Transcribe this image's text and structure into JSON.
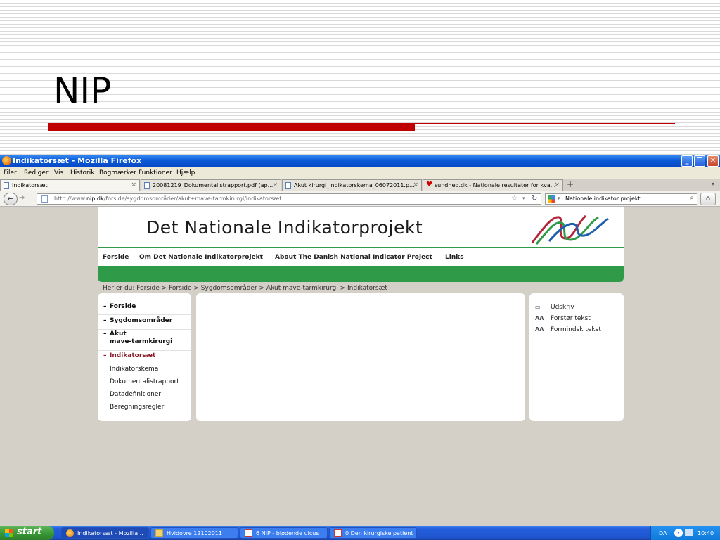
{
  "slide": {
    "title": "NIP"
  },
  "window": {
    "title": "Indikatorsæt - Mozilla Firefox"
  },
  "menu": [
    "Filer",
    "Rediger",
    "Vis",
    "Historik",
    "Bogmærker",
    "Funktioner",
    "Hjælp"
  ],
  "tabs": [
    {
      "label": "Indikatorsæt"
    },
    {
      "label": "20081219_Dokumentalistrapport.pdf (ap..."
    },
    {
      "label": "Akut kirurgi_indikatorskema_06072011.p..."
    },
    {
      "label": "sundhed.dk - Nationale resultater for kva..."
    }
  ],
  "nav": {
    "url_prefix": "http://www.",
    "url_domain": "nip.dk",
    "url_path": "/forside/sygdomsområder/akut+mave-tarmkirurgi/indikatorsæt",
    "search_text": "Nationale indikator projekt"
  },
  "site": {
    "title": "Det Nationale Indikatorprojekt",
    "nav": [
      "Forside",
      "Om Det Nationale Indikatorprojekt",
      "About The Danish National Indicator Project",
      "Links"
    ],
    "breadcrumb": "Her er du: Forside > Forside > Sygdomsområder > Akut mave-tarmkirurgi > Indikatorsæt",
    "left_menu": [
      {
        "dash": "–",
        "label": "Forside"
      },
      {
        "dash": "–",
        "label": "Sygdomsområder"
      },
      {
        "dash": "–",
        "label1": "Akut",
        "label2": "mave-tarmkirurgi"
      },
      {
        "dash": "–",
        "label": "Indikatorsæt"
      }
    ],
    "sub_menu": [
      "Indikatorskema",
      "Dokumentalistrapport",
      "Datadefinitioner",
      "Beregningsregler"
    ],
    "tools": [
      {
        "icon": "▭",
        "label": "Udskriv"
      },
      {
        "icon": "AA",
        "label": "Forstør tekst"
      },
      {
        "icon": "AA",
        "label": "Formindsk tekst"
      }
    ]
  },
  "taskbar": {
    "start": "start",
    "tasks": [
      "Indikatorsæt - Mozilla...",
      "Hvidovre 12102011",
      "6 NIP - blødende ulcus",
      "0 Den kirurgiske patient"
    ],
    "lang": "DA",
    "clock": "10:40"
  },
  "colors": {
    "accent_red": "#c00000",
    "site_green": "#2f9a48",
    "active_menu": "#8a1c2b"
  }
}
